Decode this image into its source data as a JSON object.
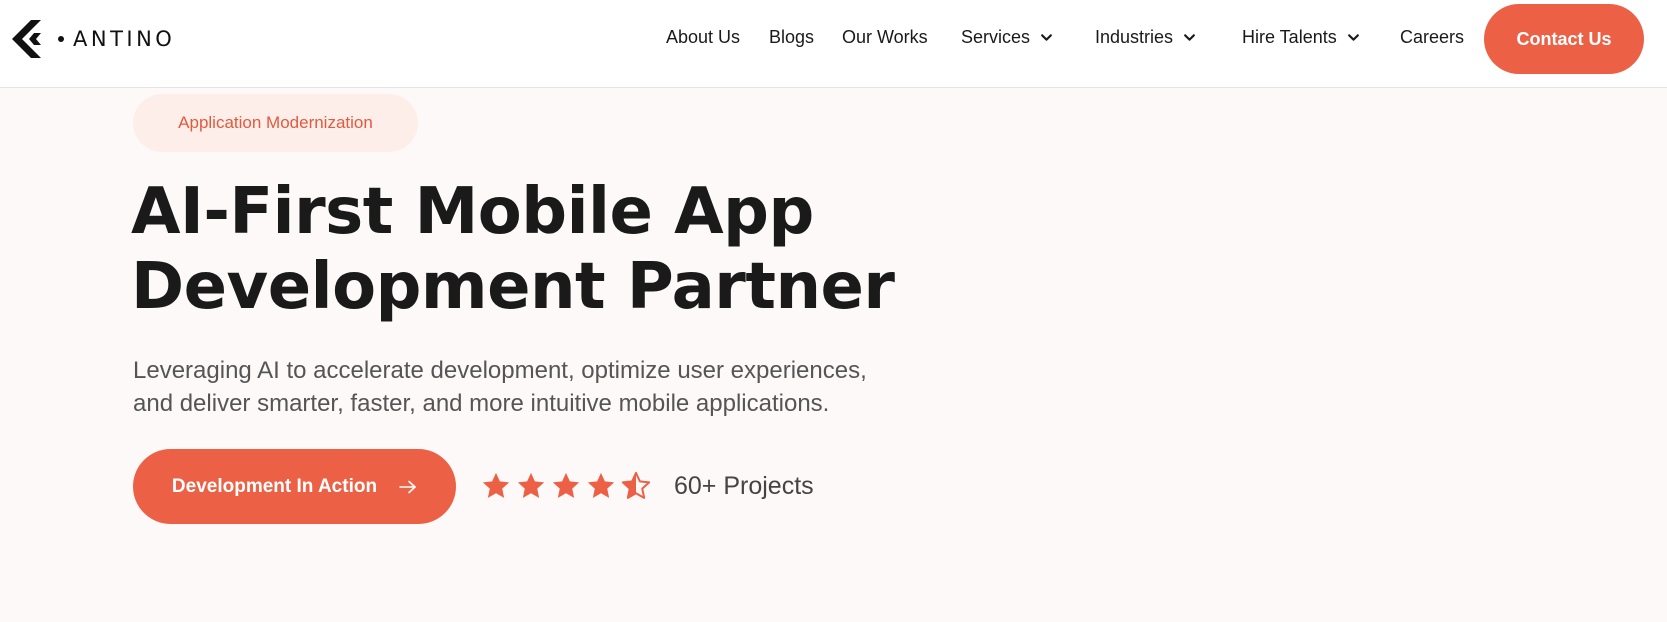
{
  "brand": {
    "name": "ANTINO",
    "accent": "#ec6145",
    "text_color": "#1a1a1a",
    "background": "#fdf9f9"
  },
  "nav": {
    "items": [
      {
        "label": "About Us",
        "has_dropdown": false
      },
      {
        "label": "Blogs",
        "has_dropdown": false
      },
      {
        "label": "Our Works",
        "has_dropdown": false
      },
      {
        "label": "Services",
        "has_dropdown": true,
        "icon": "chevron-down-icon"
      },
      {
        "label": "Industries",
        "has_dropdown": true,
        "icon": "chevron-down-icon"
      },
      {
        "label": "Hire Talents",
        "has_dropdown": true,
        "icon": "chevron-down-icon"
      },
      {
        "label": "Careers",
        "has_dropdown": false
      }
    ],
    "contact_label": "Contact Us"
  },
  "hero": {
    "tag": "Application Modernization",
    "headline_line1": "AI-First Mobile App",
    "headline_line2": "Development Partner",
    "subtext_line1": "Leveraging AI to accelerate development, optimize user experiences,",
    "subtext_line2": "and deliver smarter, faster, and more intuitive mobile applications.",
    "cta_label": "Development In Action",
    "cta_icon": "arrow-right-icon",
    "rating_value": 4.5,
    "rating_max": 5,
    "projects_label": "60+ Projects"
  }
}
